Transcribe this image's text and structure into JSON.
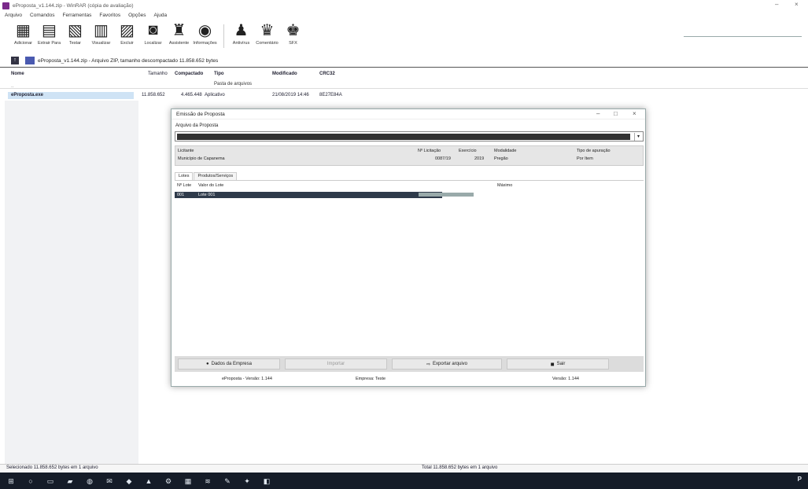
{
  "window": {
    "title": "eProposta_v1.144.zip - WinRAR (cópia de avaliação)",
    "minimize": "–",
    "close": "×"
  },
  "menu": [
    "Arquivo",
    "Comandos",
    "Ferramentas",
    "Favoritos",
    "Opções",
    "Ajuda"
  ],
  "toolbar": [
    {
      "label": "Adicionar",
      "icon": "add-archive-icon",
      "glyph": "▦"
    },
    {
      "label": "Extrair Para",
      "icon": "extract-icon",
      "glyph": "▤"
    },
    {
      "label": "Testar",
      "icon": "test-icon",
      "glyph": "▧"
    },
    {
      "label": "Visualizar",
      "icon": "view-icon",
      "glyph": "▥"
    },
    {
      "label": "Excluir",
      "icon": "delete-icon",
      "glyph": "▨"
    },
    {
      "label": "Localizar",
      "icon": "find-icon",
      "glyph": "◙"
    },
    {
      "label": "Assistente",
      "icon": "wizard-icon",
      "glyph": "♜"
    },
    {
      "label": "Informações",
      "icon": "info-icon",
      "glyph": "◉"
    },
    {
      "label": "Antivírus",
      "icon": "virus-icon",
      "glyph": "♟"
    },
    {
      "label": "Comentário",
      "icon": "comment-icon",
      "glyph": "♛"
    },
    {
      "label": "SFX",
      "icon": "sfx-icon",
      "glyph": "♚"
    }
  ],
  "address": {
    "path": "eProposta_v1.144.zip - Arquivo ZIP, tamanho descompactado 11.858.652 bytes"
  },
  "columns": {
    "name": "Nome",
    "size": "Tamanho",
    "packed": "Compactado",
    "type": "Tipo",
    "modified": "Modificado",
    "crc": "CRC32"
  },
  "parent_row": {
    "name": "..",
    "type": "Pasta de arquivos"
  },
  "file_row": {
    "name": "eProposta.exe",
    "size": "11.858.652",
    "packed": "4.465.448",
    "type": "Aplicativo",
    "modified": "21/08/2019 14:46",
    "crc": "8E27E84A"
  },
  "dialog": {
    "title": "Emissão de Proposta",
    "file_label": "Arquivo da Proposta",
    "licitante_label": "Licitante",
    "licitante_value": "Município de Capanema",
    "licitacao_label": "Nº Licitação",
    "licitacao_value": "0087/19",
    "exercicio_label": "Exercício",
    "exercicio_value": "2019",
    "modalidade_label": "Modalidade",
    "modalidade_value": "Pregão",
    "tipo_label": "Tipo de apuração",
    "tipo_value": "Por Item",
    "tabs": [
      "Lotes",
      "Produtos/Serviços"
    ],
    "table_col_lote": "Nº Lote",
    "table_col_valor": "Valor do Lote",
    "table_col_max": "Máximo",
    "row_lote": "001",
    "row_valor": "Lote 001",
    "buttons": {
      "data": "Dados da Empresa",
      "import": "Importar",
      "export": "Exportar arquivo",
      "exit": "Sair"
    },
    "status": {
      "left": "eProposta - Versão: 1.144",
      "mid": "Empresa: Teste",
      "right": "Versão: 1.144"
    }
  },
  "statusbar": {
    "left": "Selecionado 11.858.652 bytes em 1 arquivo",
    "right": "Total 11.858.652 bytes em 1 arquivo"
  },
  "taskbar": {
    "clock": "P"
  }
}
